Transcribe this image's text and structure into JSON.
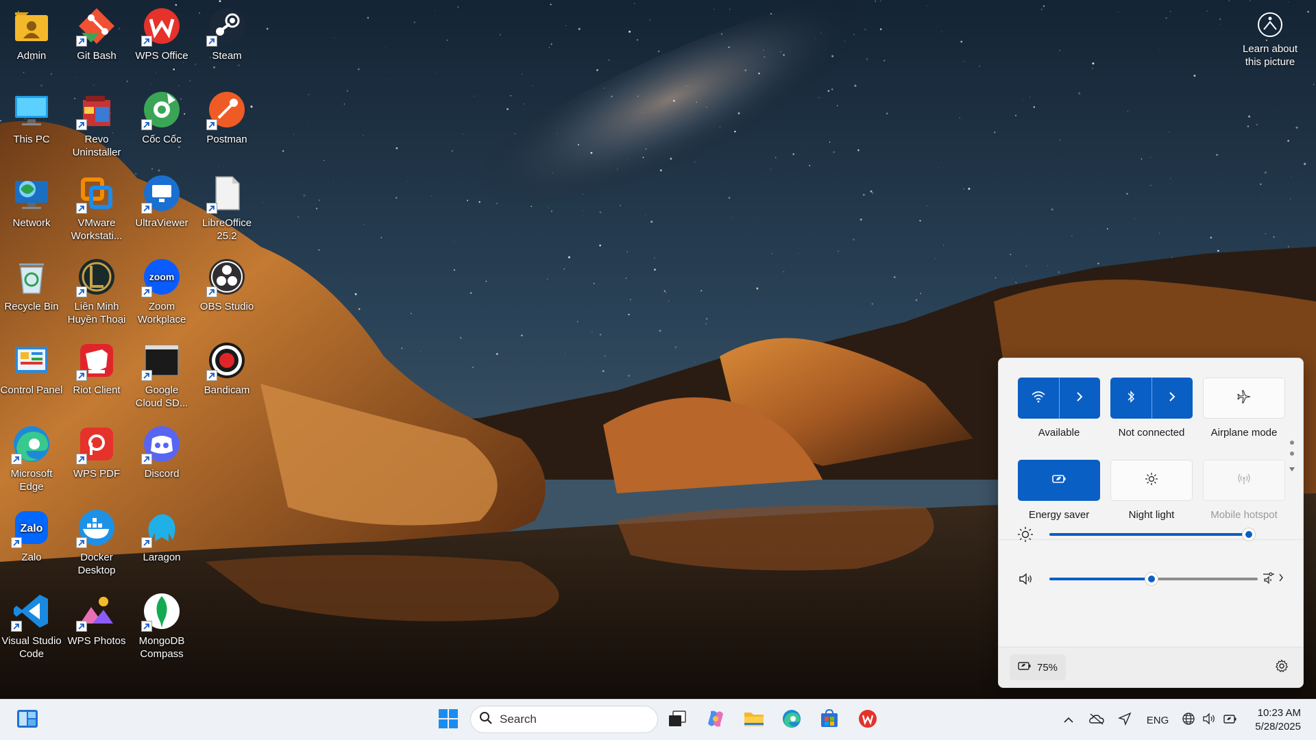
{
  "desktop": {
    "icons": [
      {
        "label": "Admin"
      },
      {
        "label": "Git Bash"
      },
      {
        "label": "WPS Office"
      },
      {
        "label": "Steam"
      },
      {
        "label": "This PC"
      },
      {
        "label": "Revo\nUninstaller"
      },
      {
        "label": "Cốc Cốc"
      },
      {
        "label": "Postman"
      },
      {
        "label": "Network"
      },
      {
        "label": "VMware\nWorkstati..."
      },
      {
        "label": "UltraViewer"
      },
      {
        "label": "LibreOffice\n25.2"
      },
      {
        "label": "Recycle Bin"
      },
      {
        "label": "Liên Minh\nHuyền Thoại"
      },
      {
        "label": "Zoom\nWorkplace"
      },
      {
        "label": "OBS Studio"
      },
      {
        "label": "Control Panel"
      },
      {
        "label": "Riot Client"
      },
      {
        "label": "Google\nCloud SD..."
      },
      {
        "label": "Bandicam"
      },
      {
        "label": "Microsoft\nEdge"
      },
      {
        "label": "WPS PDF"
      },
      {
        "label": "Discord"
      },
      {
        "label": "Zalo"
      },
      {
        "label": "Docker\nDesktop"
      },
      {
        "label": "Laragon"
      },
      {
        "label": "Visual Studio\nCode"
      },
      {
        "label": "WPS Photos"
      },
      {
        "label": "MongoDB\nCompass"
      }
    ],
    "learn_about": "Learn about\nthis picture"
  },
  "quick_settings": {
    "tiles": [
      {
        "label": "Available",
        "icon": "wifi-icon",
        "state": "on"
      },
      {
        "label": "Not connected",
        "icon": "bluetooth-icon",
        "state": "on"
      },
      {
        "label": "Airplane mode",
        "icon": "airplane-icon",
        "state": "off"
      },
      {
        "label": "Energy saver",
        "icon": "energy-saver-icon",
        "state": "on"
      },
      {
        "label": "Night light",
        "icon": "night-light-icon",
        "state": "off"
      },
      {
        "label": "Mobile hotspot",
        "icon": "hotspot-icon",
        "state": "disabled"
      }
    ],
    "brightness": 0.99,
    "volume": 0.49,
    "battery_text": "75%"
  },
  "taskbar": {
    "search_placeholder": "Search",
    "language": "ENG",
    "time": "10:23 AM",
    "date": "5/28/2025"
  },
  "colors": {
    "accent": "#0a5fc4"
  }
}
